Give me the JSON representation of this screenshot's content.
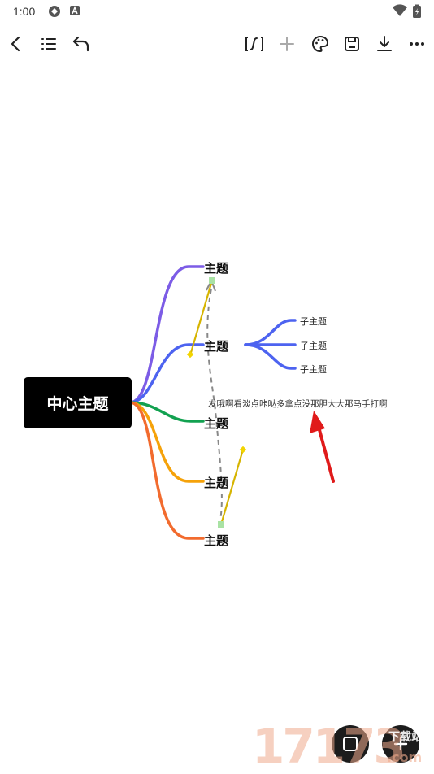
{
  "status_bar": {
    "time": "1:00",
    "icons": [
      "sync-icon",
      "a-badge-icon",
      "wifi-icon",
      "battery-charging-icon"
    ]
  },
  "toolbar": {
    "left": [
      "back-icon",
      "outline-list-icon",
      "undo-icon"
    ],
    "right": [
      "formula-icon",
      "add-icon",
      "palette-icon",
      "save-icon",
      "download-icon",
      "more-icon"
    ]
  },
  "mindmap": {
    "center": "中心主题",
    "topics": [
      {
        "label": "主题",
        "color": "#7c5ce6"
      },
      {
        "label": "主题",
        "color": "#4d63f0",
        "children": [
          "子主题",
          "子主题",
          "子主题"
        ]
      },
      {
        "label": "主题",
        "color": "#12a150"
      },
      {
        "label": "主题",
        "color": "#f5a20a"
      },
      {
        "label": "主题",
        "color": "#f26b2e"
      }
    ],
    "note": "发哦啊看淡点咔哒多拿点没那胆大大那马手打啊",
    "colors": {
      "relation_line": "#d6b400",
      "dashed_link": "#888888",
      "arrow": "#e01a1a"
    }
  },
  "watermark": {
    "text": "17173",
    "sub_text": "下载站",
    "domain": ".com"
  }
}
